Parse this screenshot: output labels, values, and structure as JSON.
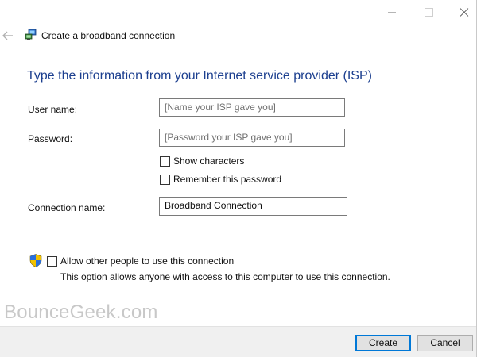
{
  "wizard": {
    "title": "Create a broadband connection",
    "heading": "Type the information from your Internet service provider (ISP)"
  },
  "form": {
    "username": {
      "label": "User name:",
      "placeholder": "[Name your ISP gave you]"
    },
    "password": {
      "label": "Password:",
      "placeholder": "[Password your ISP gave you]"
    },
    "show_characters": {
      "label": "Show characters",
      "checked": false
    },
    "remember_password": {
      "label": "Remember this password",
      "checked": false
    },
    "connection_name": {
      "label": "Connection name:",
      "value": "Broadband Connection"
    },
    "allow_others": {
      "label": "Allow other people to use this connection",
      "description": "This option allows anyone with access to this computer to use this connection.",
      "checked": false
    }
  },
  "watermark": "BounceGeek.com",
  "buttons": {
    "create": "Create",
    "cancel": "Cancel"
  },
  "icons": {
    "back": "back-arrow-icon",
    "network": "network-connection-icon",
    "shield": "uac-shield-icon"
  },
  "colors": {
    "heading": "#1c3f8f",
    "default_button_border": "#0078d7",
    "footer_bg": "#f0f0f0"
  }
}
